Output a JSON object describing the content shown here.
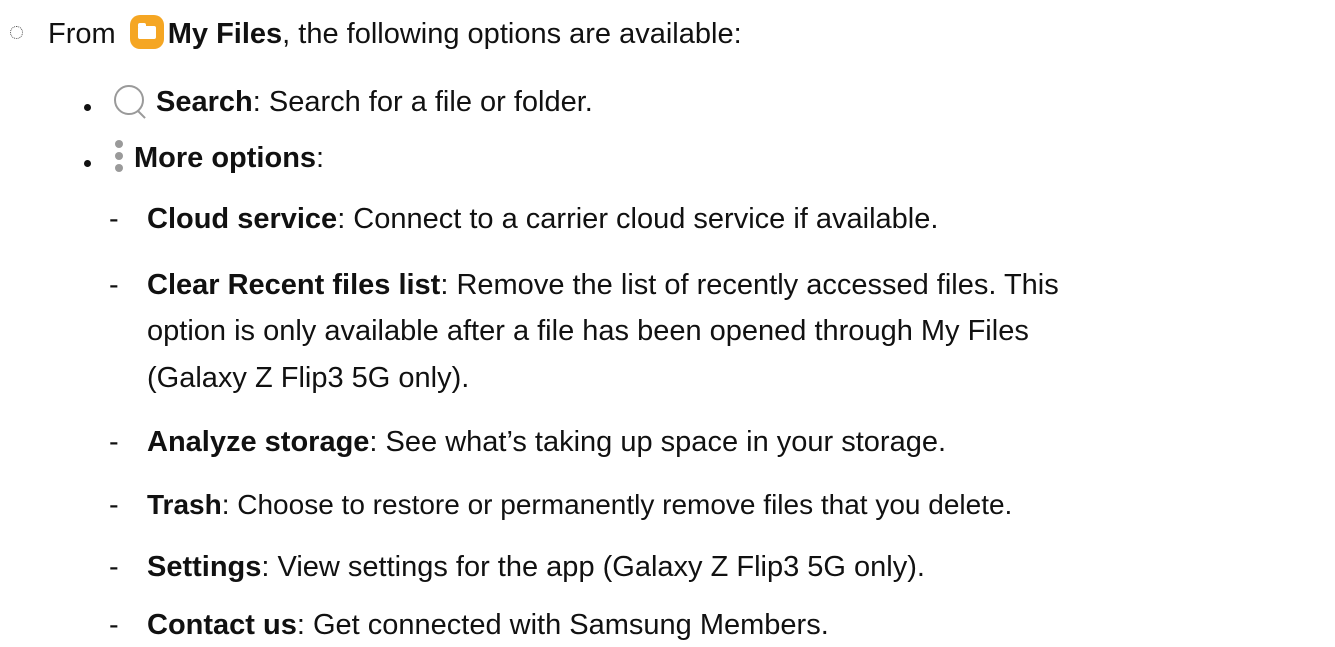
{
  "intro": {
    "prefix": "From",
    "app_name": "My Files",
    "suffix": ", the following options are available:"
  },
  "bullets": [
    {
      "icon": "search-icon",
      "term": "Search",
      "desc": ": Search for a file or folder."
    },
    {
      "icon": "more-options-icon",
      "term": "More options",
      "desc": ":"
    }
  ],
  "sub_items": [
    {
      "term": "Cloud service",
      "desc": ": Connect to a carrier cloud service if available."
    },
    {
      "term": "Clear Recent files list",
      "desc": ": Remove the list of recently accessed files. This",
      "cont": [
        "option is only available after a file has been opened through My Files",
        "(Galaxy Z Flip3 5G only)."
      ]
    },
    {
      "term": "Analyze storage",
      "desc": ": See what’s taking up space in your storage."
    },
    {
      "term": "Trash",
      "desc": ": Choose to restore or permanently remove files that you delete."
    },
    {
      "term": "Settings",
      "desc": ": View settings for the app (Galaxy Z Flip3 5G only)."
    },
    {
      "term": "Contact us",
      "desc": ": Get connected with Samsung Members."
    }
  ],
  "colors": {
    "app_icon": "#f5a623",
    "icon_gray": "#9a9a9a",
    "text": "#111111"
  }
}
